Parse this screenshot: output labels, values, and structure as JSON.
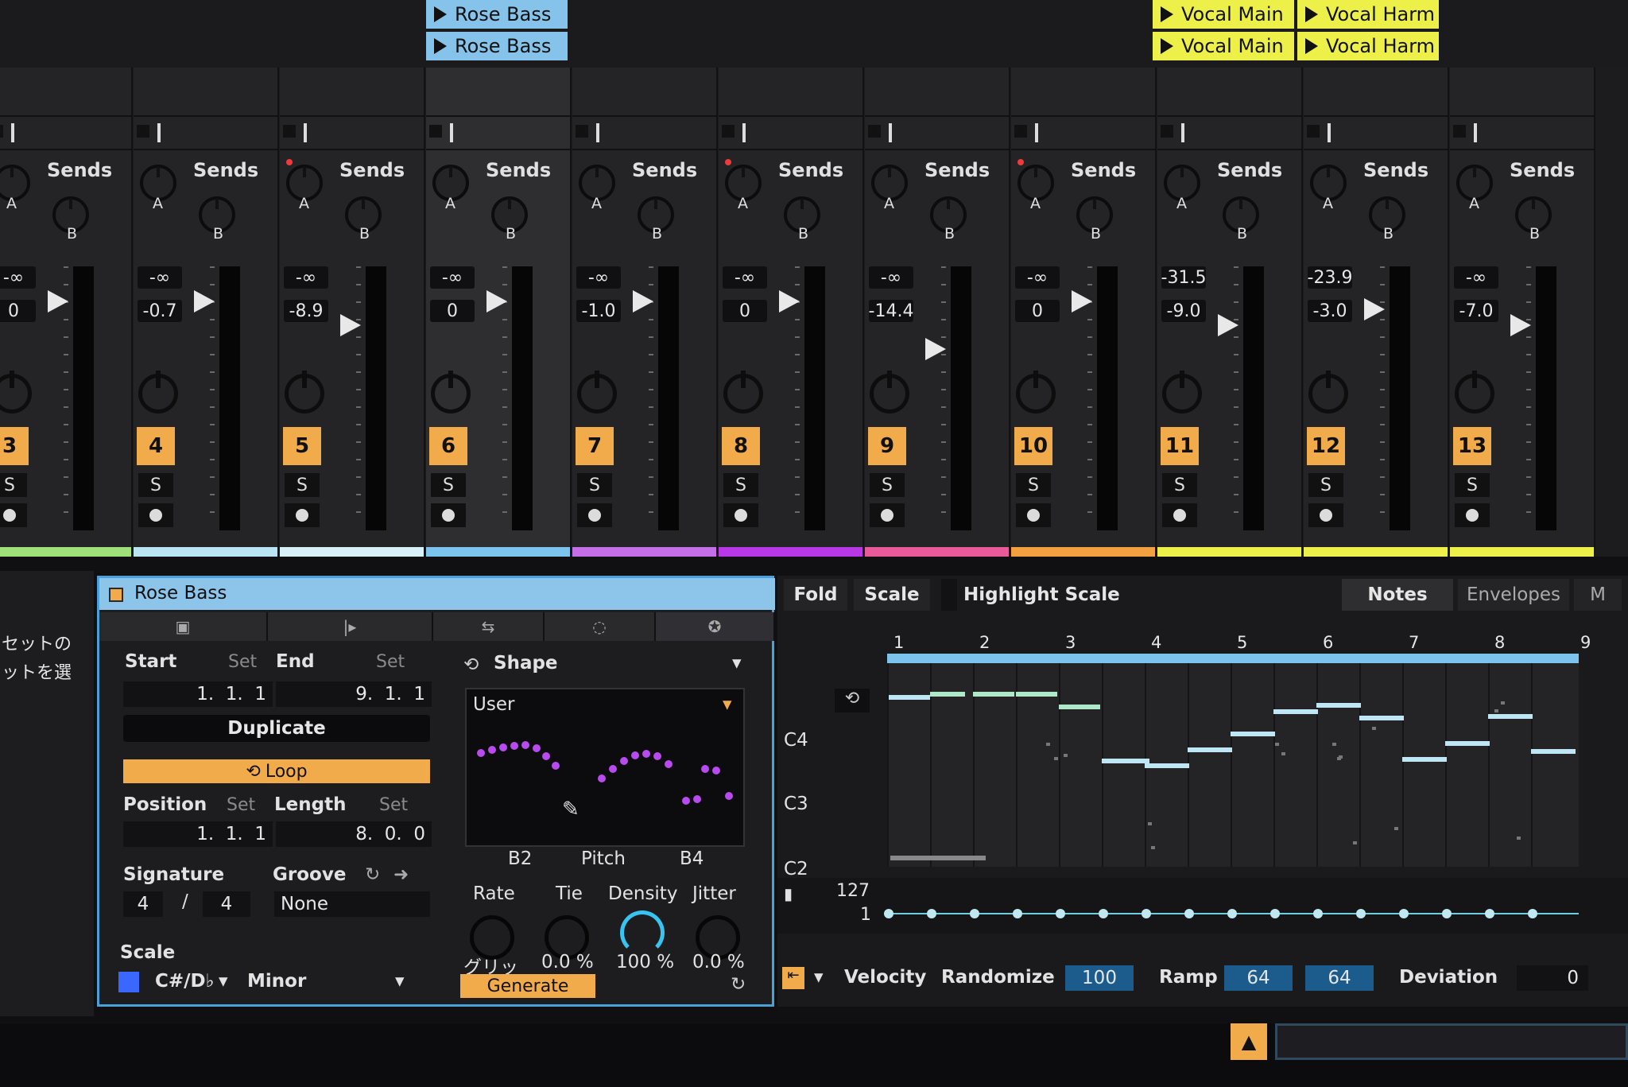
{
  "clips": {
    "rose_bass_top": "Rose Bass",
    "rose_bass_bottom": "Rose Bass",
    "vocal_main_top": "Vocal Main",
    "vocal_main_bottom": "Vocal Main",
    "vocal_harm_top": "Vocal Harm",
    "vocal_harm_bottom": "Vocal Harm"
  },
  "mixer": {
    "sends_label": "Sends",
    "send_a": "A",
    "send_b": "B",
    "solo": "S",
    "tracks": [
      {
        "num": "3",
        "peak": "-∞",
        "vol": "0",
        "color": "#9fe07a"
      },
      {
        "num": "4",
        "peak": "-∞",
        "vol": "-0.7",
        "color": "#b8e4f4"
      },
      {
        "num": "5",
        "peak": "-∞",
        "vol": "-8.9",
        "color": "#d8f0f8"
      },
      {
        "num": "6",
        "peak": "-∞",
        "vol": "0",
        "color": "#7cc4ee"
      },
      {
        "num": "7",
        "peak": "-∞",
        "vol": "-1.0",
        "color": "#c46ee8"
      },
      {
        "num": "8",
        "peak": "-∞",
        "vol": "0",
        "color": "#b838e8"
      },
      {
        "num": "9",
        "peak": "-∞",
        "vol": "-14.4",
        "color": "#e85a9a"
      },
      {
        "num": "10",
        "peak": "-∞",
        "vol": "0",
        "color": "#f2a040"
      },
      {
        "num": "11",
        "peak": "-31.5",
        "vol": "-9.0",
        "color": "#eef04a"
      },
      {
        "num": "12",
        "peak": "-23.9",
        "vol": "-3.0",
        "color": "#eef04a"
      },
      {
        "num": "13",
        "peak": "-∞",
        "vol": "-7.0",
        "color": "#eef04a"
      }
    ]
  },
  "browser": {
    "line1": "セットの",
    "line2": "ットを選"
  },
  "clip_view": {
    "title": "Rose Bass",
    "start_label": "Start",
    "set_label": "Set",
    "end_label": "End",
    "start_value": "1.  1.  1",
    "end_value": "9.  1.  1",
    "duplicate": "Duplicate",
    "loop": "Loop",
    "position_label": "Position",
    "length_label": "Length",
    "position_value": "1.  1.  1",
    "length_value": "8.  0.  0",
    "signature_label": "Signature",
    "groove_label": "Groove",
    "sig_num": "4",
    "sig_sep": "/",
    "sig_den": "4",
    "groove_value": "None",
    "scale_label": "Scale",
    "scale_root": "C#/D♭",
    "scale_mode": "Minor"
  },
  "generator": {
    "shape_label": "Shape",
    "shape_value": "User",
    "low": "B2",
    "pitch": "Pitch",
    "high": "B4",
    "rate_label": "Rate",
    "tie_label": "Tie",
    "density_label": "Density",
    "jitter_label": "Jitter",
    "rate_value": "グリッ",
    "tie_value": "0.0 %",
    "density_value": "100 %",
    "jitter_value": "0.0 %",
    "generate": "Generate"
  },
  "piano_roll": {
    "fold": "Fold",
    "scale": "Scale",
    "highlight_scale": "Highlight Scale",
    "notes_tab": "Notes",
    "envelopes_tab": "Envelopes",
    "more_tab": "M",
    "bars": [
      "1",
      "2",
      "3",
      "4",
      "5",
      "6",
      "7",
      "8",
      "9"
    ],
    "key_c4": "C4",
    "key_c3": "C3",
    "key_c2": "C2",
    "vel_max": "127",
    "vel_min": "1",
    "velocity_label": "Velocity",
    "randomize_label": "Randomize",
    "randomize_value": "100",
    "ramp_label": "Ramp",
    "ramp_a": "64",
    "ramp_b": "64",
    "deviation_label": "Deviation",
    "deviation_value": "0"
  },
  "colors": {
    "accent_orange": "#f2ab4a",
    "clip_blue": "#86c3ea",
    "clip_yellow": "#eef04a",
    "active_cyan": "#38c4f0",
    "purple_dots": "#b84af0"
  }
}
